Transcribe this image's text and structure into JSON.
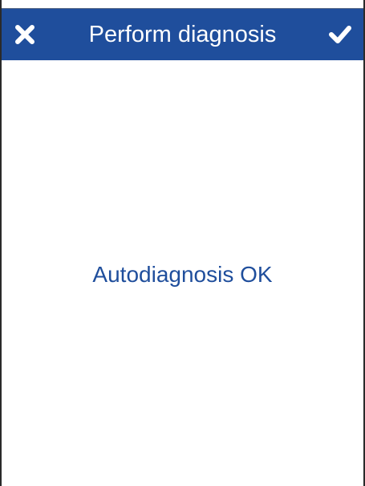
{
  "header": {
    "title": "Perform diagnosis",
    "cancel_icon": "close-icon",
    "confirm_icon": "check-icon",
    "background_color": "#1f4e9c",
    "text_color": "#ffffff"
  },
  "main": {
    "message": "Autodiagnosis OK",
    "message_color": "#1f4e9c"
  }
}
